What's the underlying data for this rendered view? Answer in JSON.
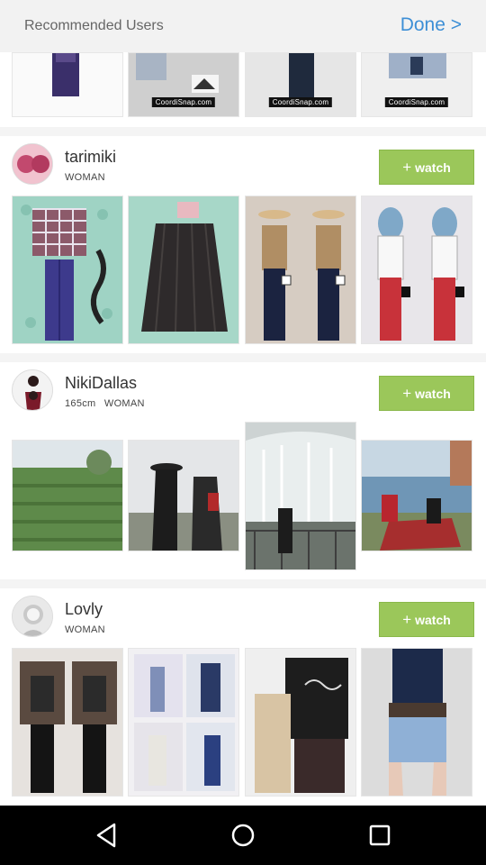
{
  "header": {
    "title": "Recommended Users",
    "done_label": "Done >"
  },
  "users": [
    {
      "name": "tarimiki",
      "height": "",
      "gender": "WOMAN",
      "watch_label": "watch"
    },
    {
      "name": "NikiDallas",
      "height": "165cm",
      "gender": "WOMAN",
      "watch_label": "watch"
    },
    {
      "name": "Lovly",
      "height": "",
      "gender": "WOMAN",
      "watch_label": "watch"
    }
  ],
  "thumb_brand": "CoordiSnap.com",
  "icons": {
    "watch": "plus-icon",
    "nav_back": "back-triangle-icon",
    "nav_home": "home-circle-icon",
    "nav_recents": "recents-square-icon"
  },
  "colors": {
    "accent_link": "#3d8fd6",
    "watch_button": "#9bc75a",
    "header_bg": "#f2f2f2",
    "nav_bg": "#000000"
  }
}
